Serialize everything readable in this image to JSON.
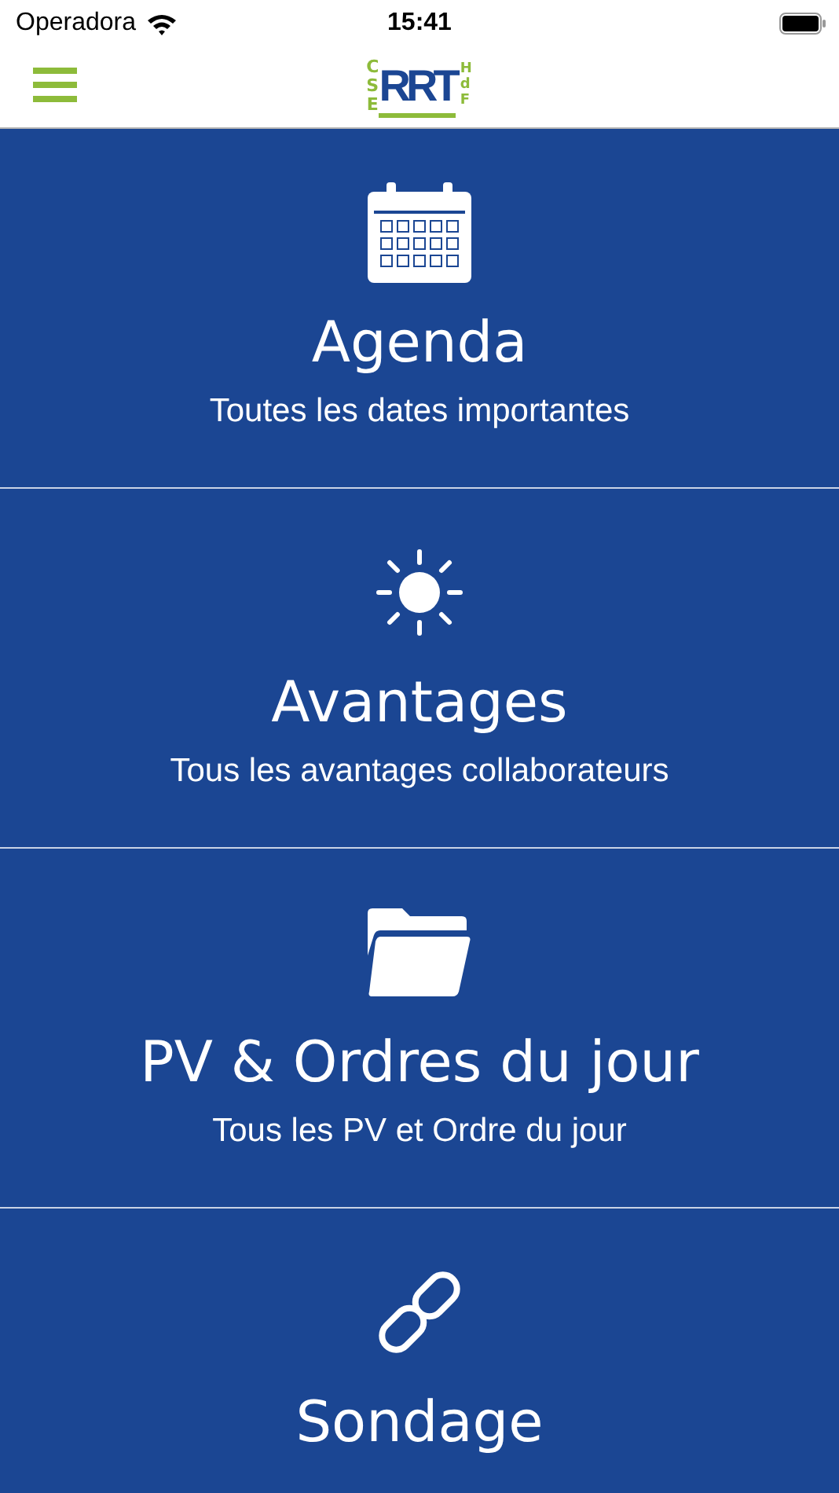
{
  "status_bar": {
    "carrier": "Operadora",
    "time": "15:41"
  },
  "nav": {
    "logo": {
      "side": "CSE",
      "main": "RRT",
      "tag": "HdF"
    }
  },
  "tiles": [
    {
      "kind": "calendar",
      "title": "Agenda",
      "subtitle": "Toutes les dates importantes"
    },
    {
      "kind": "sun",
      "title": "Avantages",
      "subtitle": "Tous les avantages collaborateurs"
    },
    {
      "kind": "folder",
      "title": "PV & Ordres du jour",
      "subtitle": "Tous les PV et Ordre du jour"
    },
    {
      "kind": "link",
      "title": "Sondage"
    }
  ]
}
